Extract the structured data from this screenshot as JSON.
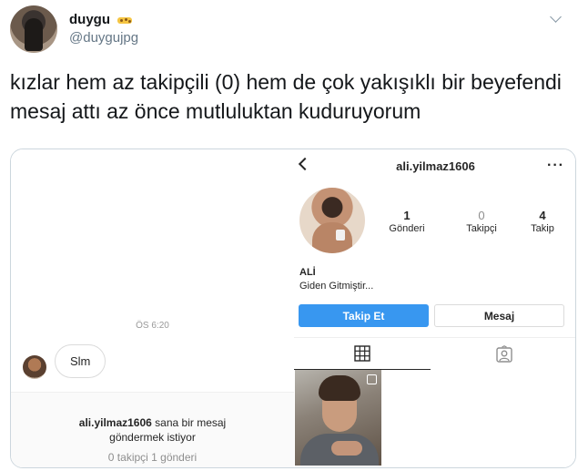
{
  "tweet": {
    "display_name": "duygu",
    "handle": "@duygujpg",
    "text": "kızlar hem az takipçili (0) hem de çok yakışıklı bir beyefendi mesaj attı az önce mutluluktan kuduruyorum",
    "emoji_icon": "leopard-emoji-icon"
  },
  "dm": {
    "time_label": "ÖS 6:20",
    "message": "Slm",
    "request_user": "ali.yilmaz1606",
    "request_text_1": "sana bir mesaj",
    "request_text_2": "göndermek istiyor",
    "request_stats": "0 takipçi 1 gönderi"
  },
  "profile": {
    "username": "ali.yilmaz1606",
    "more": "···",
    "posts_count": "1",
    "posts_label": "Gönderi",
    "followers_count": "0",
    "followers_label": "Takipçi",
    "following_count": "4",
    "following_label": "Takip",
    "bio_name": "ALİ",
    "bio_text": "Giden Gitmiştir...",
    "follow_label": "Takip Et",
    "message_label": "Mesaj",
    "accent_color": "#3897f0"
  }
}
